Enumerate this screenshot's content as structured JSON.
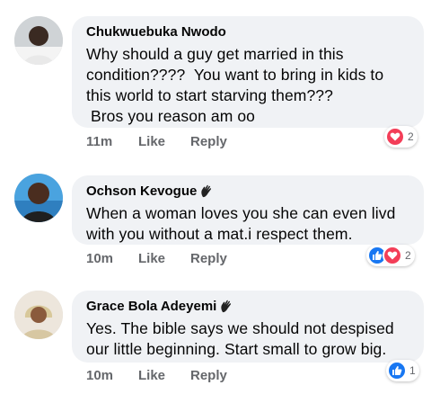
{
  "comments": [
    {
      "author": "Chukwuebuka Nwodo",
      "text": "Why should a guy get married in this\ncondition????  You want to bring in kids to\nthis world to start starving them???\n Bros you reason am oo",
      "time": "11m",
      "like_label": "Like",
      "reply_label": "Reply",
      "reactions": [
        "heart-icon"
      ],
      "reaction_count": "2"
    },
    {
      "author": "Ochson Kevogue",
      "text": "When a woman loves you she can even livd\nwith you without a mat.i respect them.",
      "time": "10m",
      "like_label": "Like",
      "reply_label": "Reply",
      "reactions": [
        "thumbs-up-icon",
        "heart-icon"
      ],
      "reaction_count": "2"
    },
    {
      "author": "Grace Bola Adeyemi",
      "text": "Yes. The bible says we should not despised\nour little beginning. Start small to grow big.",
      "time": "10m",
      "like_label": "Like",
      "reply_label": "Reply",
      "reactions": [
        "thumbs-up-icon"
      ],
      "reaction_count": "1"
    }
  ],
  "colors": {
    "like_blue": "#1877f2",
    "love_red": "#f33e58",
    "bubble_bg": "#f0f2f5",
    "meta_gray": "#65676b"
  }
}
